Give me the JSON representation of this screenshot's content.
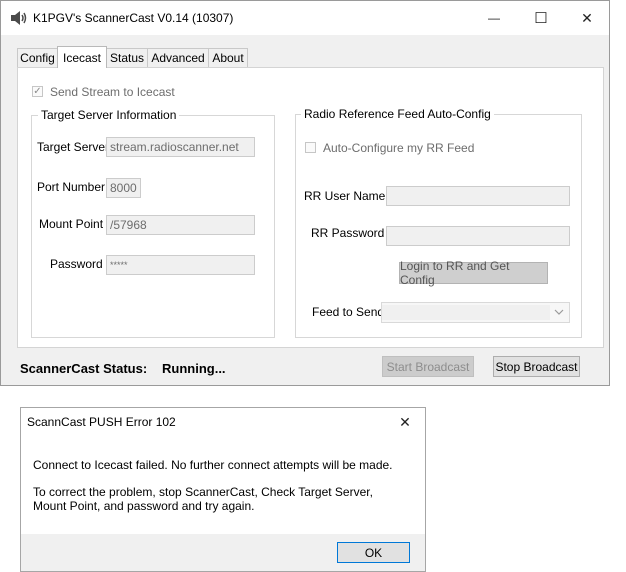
{
  "window": {
    "title": "K1PGV's ScannerCast V0.14 (10307)",
    "controls": {
      "minimize": "—",
      "maximize": "☐",
      "close": "✕"
    }
  },
  "tabs": [
    {
      "label": "Config"
    },
    {
      "label": "Icecast",
      "active": true
    },
    {
      "label": "Status"
    },
    {
      "label": "Advanced"
    },
    {
      "label": "About"
    }
  ],
  "icecast": {
    "send_stream_label": "Send Stream to Icecast",
    "send_stream_checked": true,
    "target_group_title": "Target Server Information",
    "target_server_label": "Target Server",
    "target_server_value": "stream.radioscanner.net",
    "port_label": "Port Number",
    "port_value": "8000",
    "mount_label": "Mount Point",
    "mount_value": "/57968",
    "password_label": "Password",
    "password_value": "*****"
  },
  "rr": {
    "group_title": "Radio Reference Feed Auto-Config",
    "auto_configure_label": "Auto-Configure my RR Feed",
    "auto_configure_checked": false,
    "user_label": "RR User Name",
    "user_value": "",
    "password_label": "RR Password",
    "password_value": "",
    "login_button": "Login to RR and Get Config",
    "feed_label": "Feed to Send",
    "feed_value": ""
  },
  "status": {
    "label": "ScannerCast Status:",
    "value": "Running..."
  },
  "buttons": {
    "start": "Start Broadcast",
    "stop": "Stop Broadcast"
  },
  "dialog": {
    "title": "ScannCast PUSH Error 102",
    "close": "✕",
    "line1": "Connect to Icecast failed. No further connect attempts will be made.",
    "line2": "To correct the problem, stop ScannerCast, Check Target Server, Mount Point, and password and try again.",
    "ok_button": "OK"
  }
}
